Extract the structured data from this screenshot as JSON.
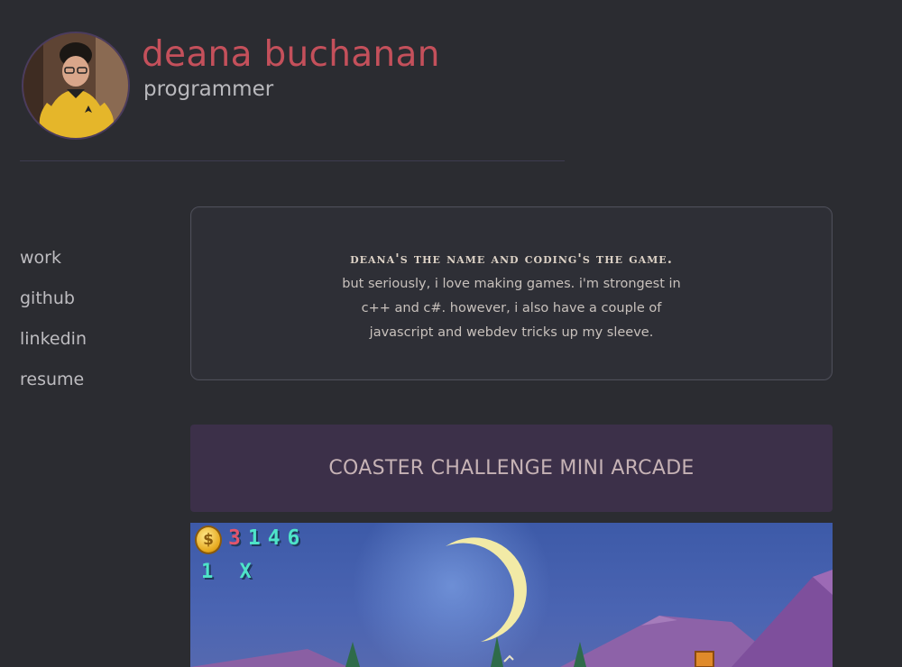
{
  "header": {
    "name": "deana buchanan",
    "role": "programmer"
  },
  "nav": {
    "items": [
      "work",
      "github",
      "linkedin",
      "resume"
    ]
  },
  "intro": {
    "tagline": "deana's the name and coding's the game.",
    "body": "but seriously, i love making games. i'm strongest in c++ and c#. however, i also have a couple of javascript and webdev tricks up my sleeve."
  },
  "project": {
    "title": "COASTER CHALLENGE MINI ARCADE",
    "game": {
      "coin_symbol": "$",
      "score_first_digit": "3",
      "score_rest": "146",
      "lives": "1 X"
    }
  },
  "colors": {
    "background": "#2b2c31",
    "name": "#c4505b",
    "banner": "#3c3049"
  }
}
